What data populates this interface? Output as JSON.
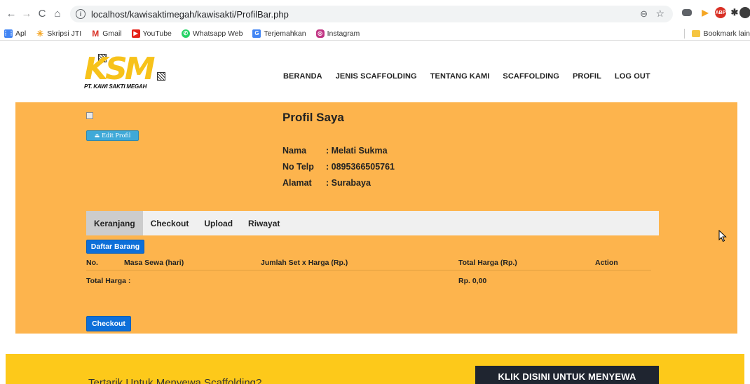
{
  "browser": {
    "url": "localhost/kawisaktimegah/kawisakti/ProfilBar.php",
    "bookmarks": [
      {
        "label": "Apl",
        "icon": "apps-grid-icon",
        "color": "#4285f4"
      },
      {
        "label": "Skripsi JTI",
        "icon": "star-burst-icon",
        "color": "#f5a623"
      },
      {
        "label": "Gmail",
        "icon": "gmail-icon",
        "color": "#d93025"
      },
      {
        "label": "YouTube",
        "icon": "youtube-icon",
        "color": "#e62117"
      },
      {
        "label": "Whatsapp Web",
        "icon": "whatsapp-icon",
        "color": "#25d366"
      },
      {
        "label": "Terjemahkan",
        "icon": "translate-icon",
        "color": "#4285f4"
      },
      {
        "label": "Instagram",
        "icon": "instagram-icon",
        "color": "#c13584"
      }
    ],
    "other_bookmarks": "Bookmark lain"
  },
  "site": {
    "logo_text": "KSM",
    "logo_sub": "PT. KAWI SAKTI MEGAH",
    "nav": [
      "BERANDA",
      "JENIS SCAFFOLDING",
      "TENTANG KAMI",
      "SCAFFOLDING",
      "PROFIL",
      "LOG OUT"
    ]
  },
  "profile": {
    "title": "Profil Saya",
    "edit_label": "Edit Profil",
    "fields": [
      {
        "label": "Nama",
        "value": ": Melati Sukma"
      },
      {
        "label": "No Telp",
        "value": ": 0895366505761"
      },
      {
        "label": "Alamat",
        "value": ": Surabaya"
      }
    ]
  },
  "tabs": [
    "Keranjang",
    "Checkout",
    "Upload",
    "Riwayat"
  ],
  "cart": {
    "list_button": "Daftar Barang",
    "columns": [
      "No.",
      "Masa Sewa (hari)",
      "Jumlah Set x Harga (Rp.)",
      "Total Harga (Rp.)",
      "Action"
    ],
    "total_label": "Total Harga :",
    "total_value": "Rp. 0,00",
    "checkout_button": "Checkout"
  },
  "cta": {
    "text": "Tertarik Untuk Menyewa Scaffolding?",
    "button": "KLIK DISINI UNTUK MENYEWA"
  }
}
